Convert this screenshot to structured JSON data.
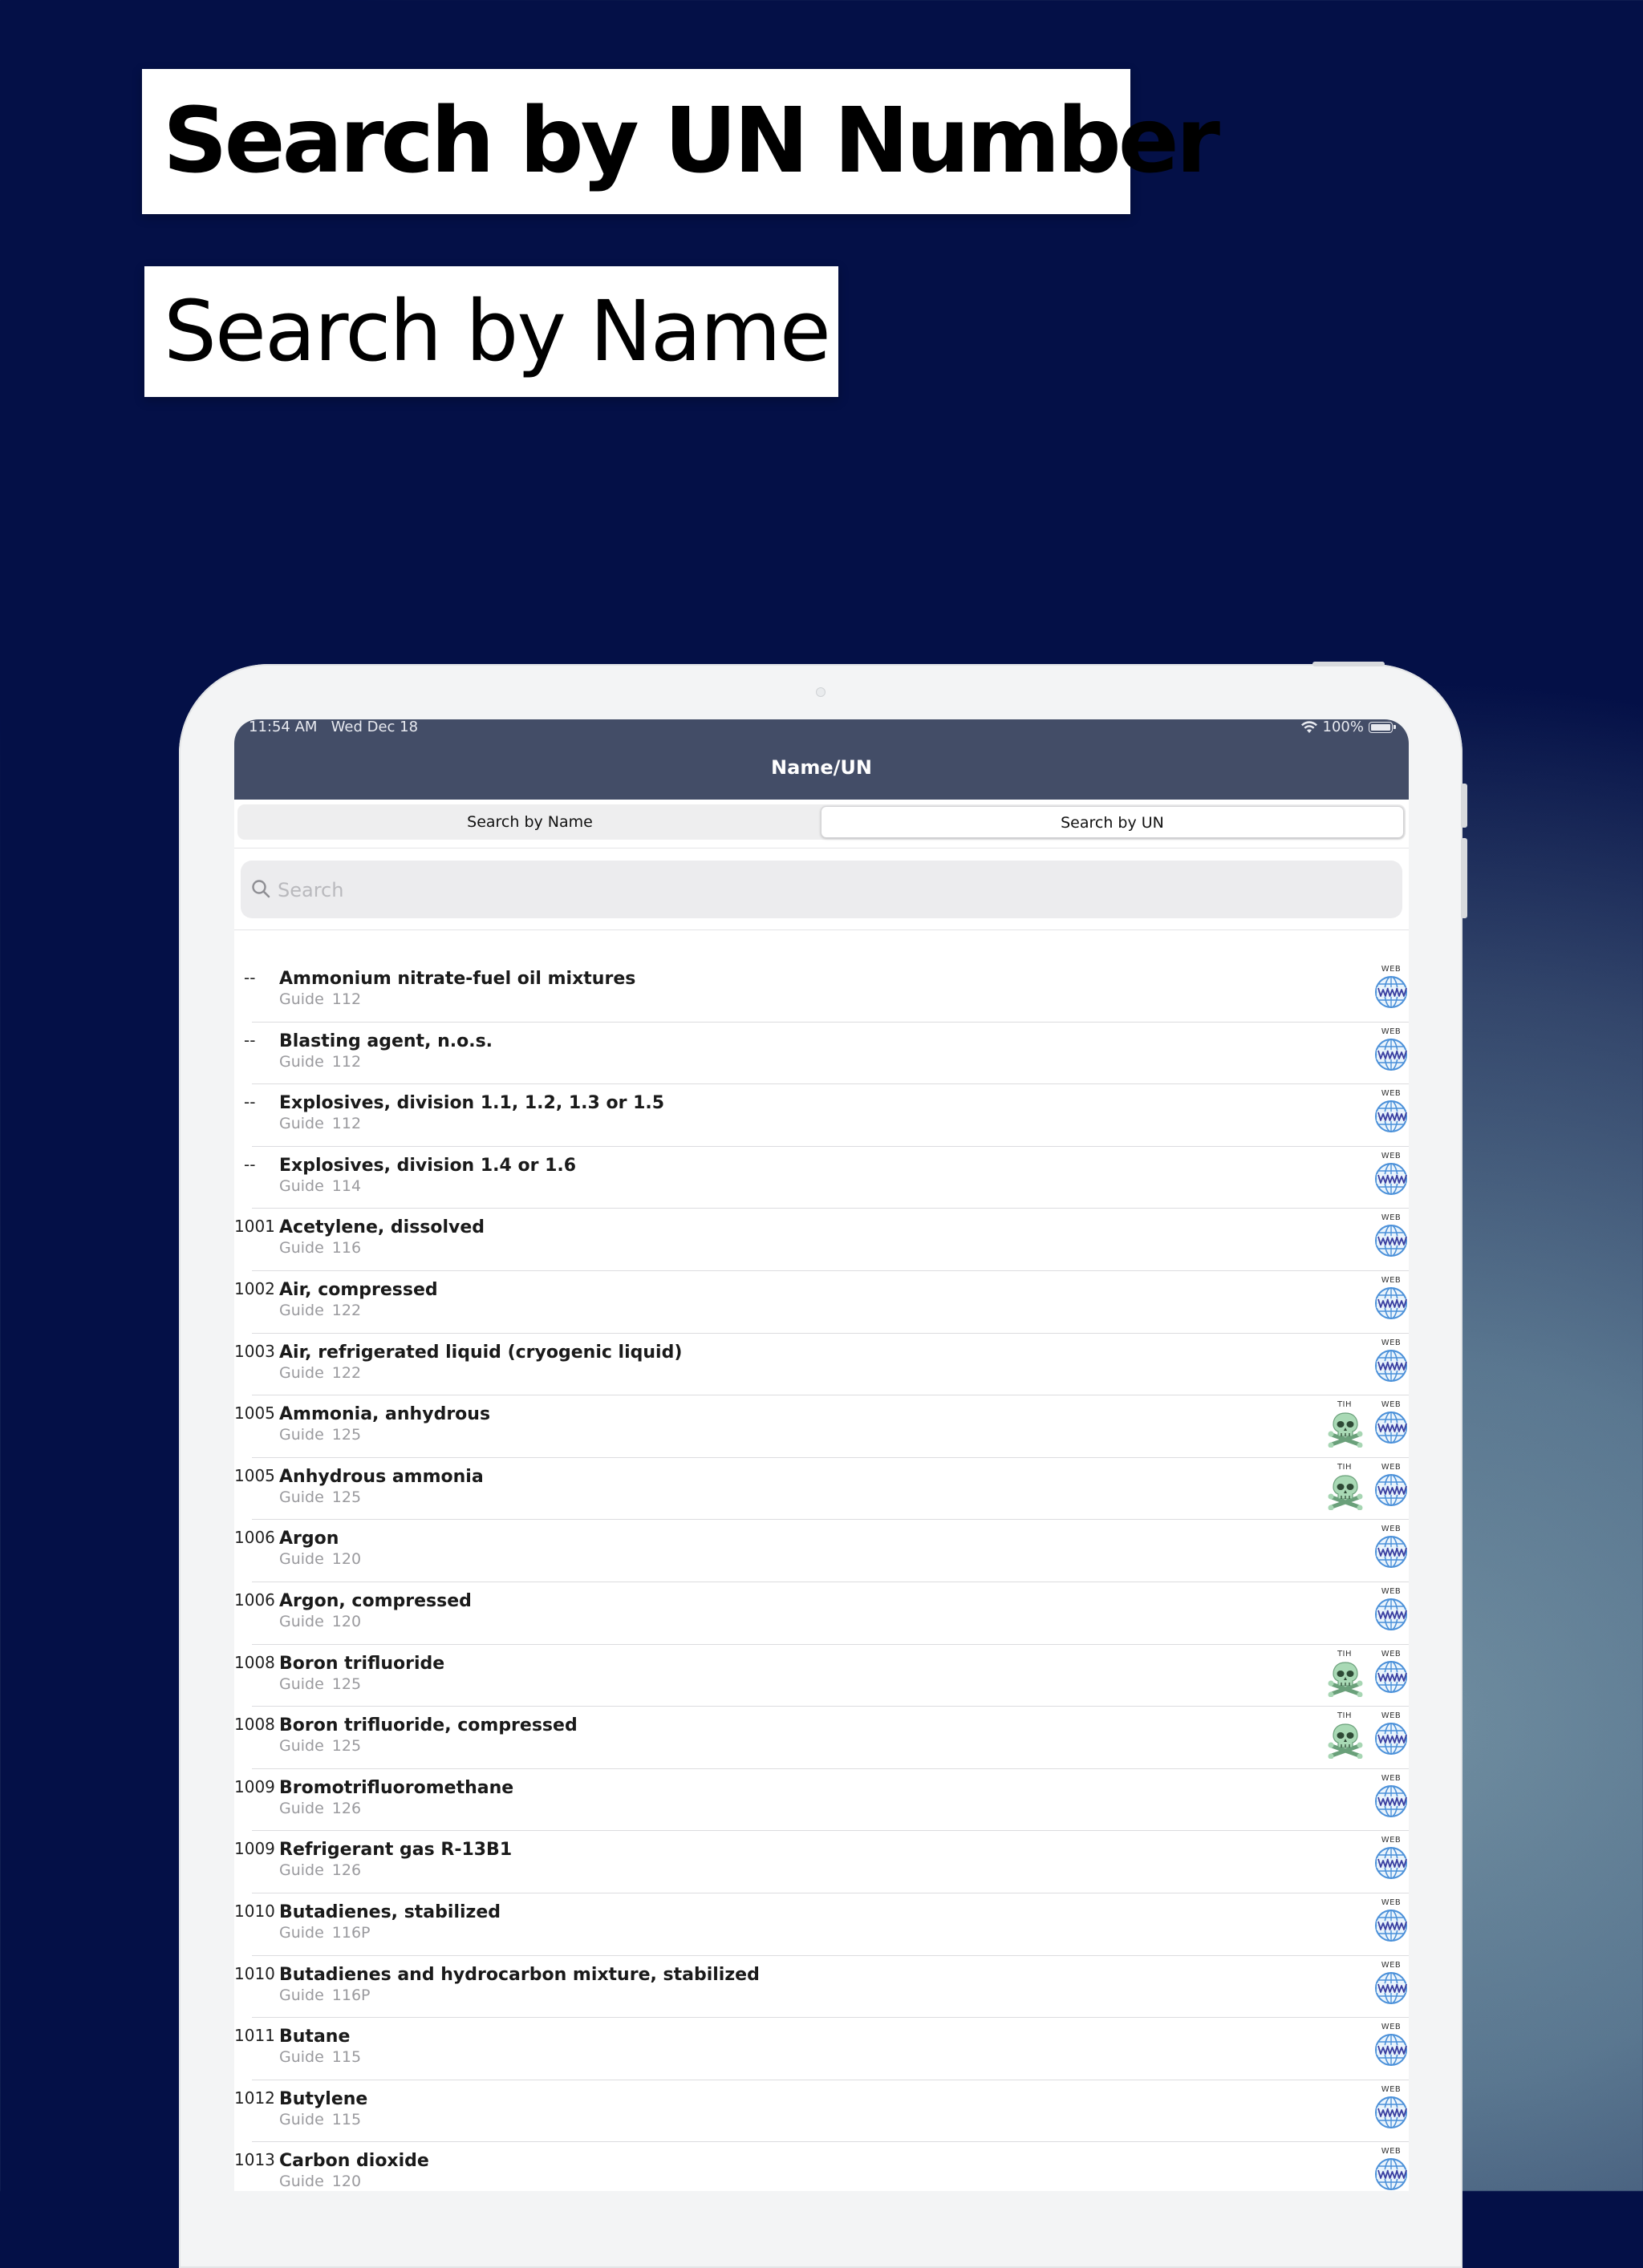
{
  "banners": {
    "un_number": "Search by UN Number",
    "name": "Search by Name"
  },
  "status_bar": {
    "time": "11:54 AM",
    "date": "Wed Dec 18",
    "battery": "100%"
  },
  "nav": {
    "title": "Name/UN"
  },
  "segments": [
    {
      "label": "Search by Name",
      "selected": false
    },
    {
      "label": "Search by UN",
      "selected": true
    }
  ],
  "search": {
    "placeholder": "Search",
    "value": ""
  },
  "badges": {
    "web_label": "WEB",
    "tih_label": "TIH"
  },
  "guide_label": "Guide",
  "rows": [
    {
      "un": "--",
      "name": "Ammonium nitrate-fuel oil mixtures",
      "guide": "112",
      "tih": false
    },
    {
      "un": "--",
      "name": "Blasting agent, n.o.s.",
      "guide": "112",
      "tih": false
    },
    {
      "un": "--",
      "name": "Explosives, division 1.1, 1.2, 1.3 or 1.5",
      "guide": "112",
      "tih": false
    },
    {
      "un": "--",
      "name": "Explosives, division 1.4 or 1.6",
      "guide": "114",
      "tih": false
    },
    {
      "un": "1001",
      "name": "Acetylene, dissolved",
      "guide": "116",
      "tih": false
    },
    {
      "un": "1002",
      "name": "Air, compressed",
      "guide": "122",
      "tih": false
    },
    {
      "un": "1003",
      "name": "Air, refrigerated liquid (cryogenic liquid)",
      "guide": "122",
      "tih": false
    },
    {
      "un": "1005",
      "name": "Ammonia, anhydrous",
      "guide": "125",
      "tih": true
    },
    {
      "un": "1005",
      "name": "Anhydrous ammonia",
      "guide": "125",
      "tih": true
    },
    {
      "un": "1006",
      "name": "Argon",
      "guide": "120",
      "tih": false
    },
    {
      "un": "1006",
      "name": "Argon, compressed",
      "guide": "120",
      "tih": false
    },
    {
      "un": "1008",
      "name": "Boron trifluoride",
      "guide": "125",
      "tih": true
    },
    {
      "un": "1008",
      "name": "Boron trifluoride, compressed",
      "guide": "125",
      "tih": true
    },
    {
      "un": "1009",
      "name": "Bromotrifluoromethane",
      "guide": "126",
      "tih": false
    },
    {
      "un": "1009",
      "name": "Refrigerant gas R-13B1",
      "guide": "126",
      "tih": false
    },
    {
      "un": "1010",
      "name": "Butadienes, stabilized",
      "guide": "116P",
      "tih": false
    },
    {
      "un": "1010",
      "name": "Butadienes and hydrocarbon mixture, stabilized",
      "guide": "116P",
      "tih": false
    },
    {
      "un": "1011",
      "name": "Butane",
      "guide": "115",
      "tih": false
    },
    {
      "un": "1012",
      "name": "Butylene",
      "guide": "115",
      "tih": false
    },
    {
      "un": "1013",
      "name": "Carbon dioxide",
      "guide": "120",
      "tih": false
    }
  ]
}
